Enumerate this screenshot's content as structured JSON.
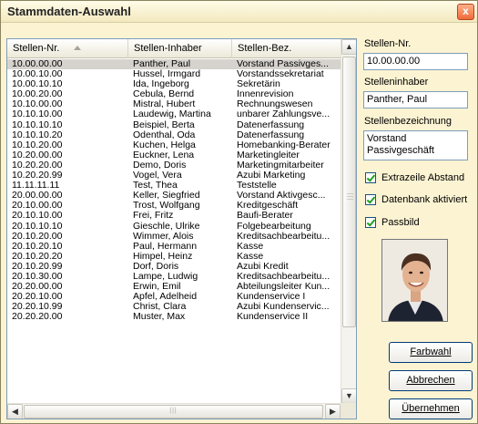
{
  "window": {
    "title": "Stammdaten-Auswahl",
    "close_label": "x"
  },
  "grid": {
    "columns": [
      {
        "label": "Stellen-Nr."
      },
      {
        "label": "Stellen-Inhaber"
      },
      {
        "label": "Stellen-Bez."
      }
    ],
    "sorted_column": "Stellen-Nr.",
    "sort_direction": "ascending",
    "selected_row": 0,
    "rows": [
      [
        "10.00.00.00",
        "Panther, Paul",
        "Vorstand Passivges..."
      ],
      [
        "10.00.10.00",
        "Hussel, Irmgard",
        "Vorstandssekretariat"
      ],
      [
        "10.00.10.10",
        "Ida, Ingeborg",
        "Sekretärin"
      ],
      [
        "10.00.20.00",
        "Cebula, Bernd",
        "Innenrevision"
      ],
      [
        "10.10.00.00",
        "Mistral, Hubert",
        "Rechnungswesen"
      ],
      [
        "10.10.10.00",
        "Laudewig, Martina",
        "unbarer Zahlungsve..."
      ],
      [
        "10.10.10.10",
        "Beispiel, Berta",
        "Datenerfassung"
      ],
      [
        "10.10.10.20",
        "Odenthal, Oda",
        "Datenerfassung"
      ],
      [
        "10.10.20.00",
        "Kuchen, Helga",
        "Homebanking-Berater"
      ],
      [
        "10.20.00.00",
        "Euckner, Lena",
        "Marketingleiter"
      ],
      [
        "10.20.20.00",
        "Demo, Doris",
        "Marketingmitarbeiter"
      ],
      [
        "10.20.20.99",
        "Vogel, Vera",
        "Azubi Marketing"
      ],
      [
        "11.11.11.11",
        "Test, Thea",
        "Teststelle"
      ],
      [
        "20.00.00.00",
        "Keller, Siegfried",
        "Vorstand Aktivgesc..."
      ],
      [
        "20.10.00.00",
        "Trost, Wolfgang",
        "Kreditgeschäft"
      ],
      [
        "20.10.10.00",
        "Frei, Fritz",
        "Baufi-Berater"
      ],
      [
        "20.10.10.10",
        "Gieschle, Ulrike",
        "Folgebearbeitung"
      ],
      [
        "20.10.20.00",
        "Wimmer, Alois",
        "Kreditsachbearbeitu..."
      ],
      [
        "20.10.20.10",
        "Paul, Hermann",
        "Kasse"
      ],
      [
        "20.10.20.20",
        "Himpel, Heinz",
        "Kasse"
      ],
      [
        "20.10.20.99",
        "Dorf, Doris",
        "Azubi Kredit"
      ],
      [
        "20.10.30.00",
        "Lampe, Ludwig",
        "Kreditsachbearbeitu..."
      ],
      [
        "20.20.00.00",
        "Erwin, Emil",
        "Abteilungsleiter Kun..."
      ],
      [
        "20.20.10.00",
        "Apfel, Adelheid",
        "Kundenservice I"
      ],
      [
        "20.20.10.99",
        "Christ, Clara",
        "Azubi Kundenservic..."
      ],
      [
        "20.20.20.00",
        "Muster, Max",
        "Kundenservice II"
      ]
    ],
    "scroll_up_icon": "chevron-up-icon",
    "scroll_down_icon": "chevron-down-icon"
  },
  "details": {
    "stellen_nr_label": "Stellen-Nr.",
    "stellen_nr_value": "10.00.00.00",
    "inhaber_label": "Stelleninhaber",
    "inhaber_value": "Panther, Paul",
    "bezeichnung_label": "Stellenbezeichnung",
    "bezeichnung_value_line1": "Vorstand",
    "bezeichnung_value_line2": "Passivgeschäft",
    "checkboxes": [
      {
        "label": "Extrazeile Abstand",
        "checked": true
      },
      {
        "label": "Datenbank aktiviert",
        "checked": true
      },
      {
        "label": "Passbild",
        "checked": true
      }
    ],
    "photo": "portrait-photo"
  },
  "buttons": {
    "farbwahl": "Farbwahl",
    "abbrechen": "Abbrechen",
    "uebernehmen": "Übernehmen"
  },
  "colors": {
    "window_bg": "#fbf3d2",
    "selection_bg": "#d6d3ce",
    "close_button": "#f06a3a",
    "check_mark": "#21a121"
  }
}
